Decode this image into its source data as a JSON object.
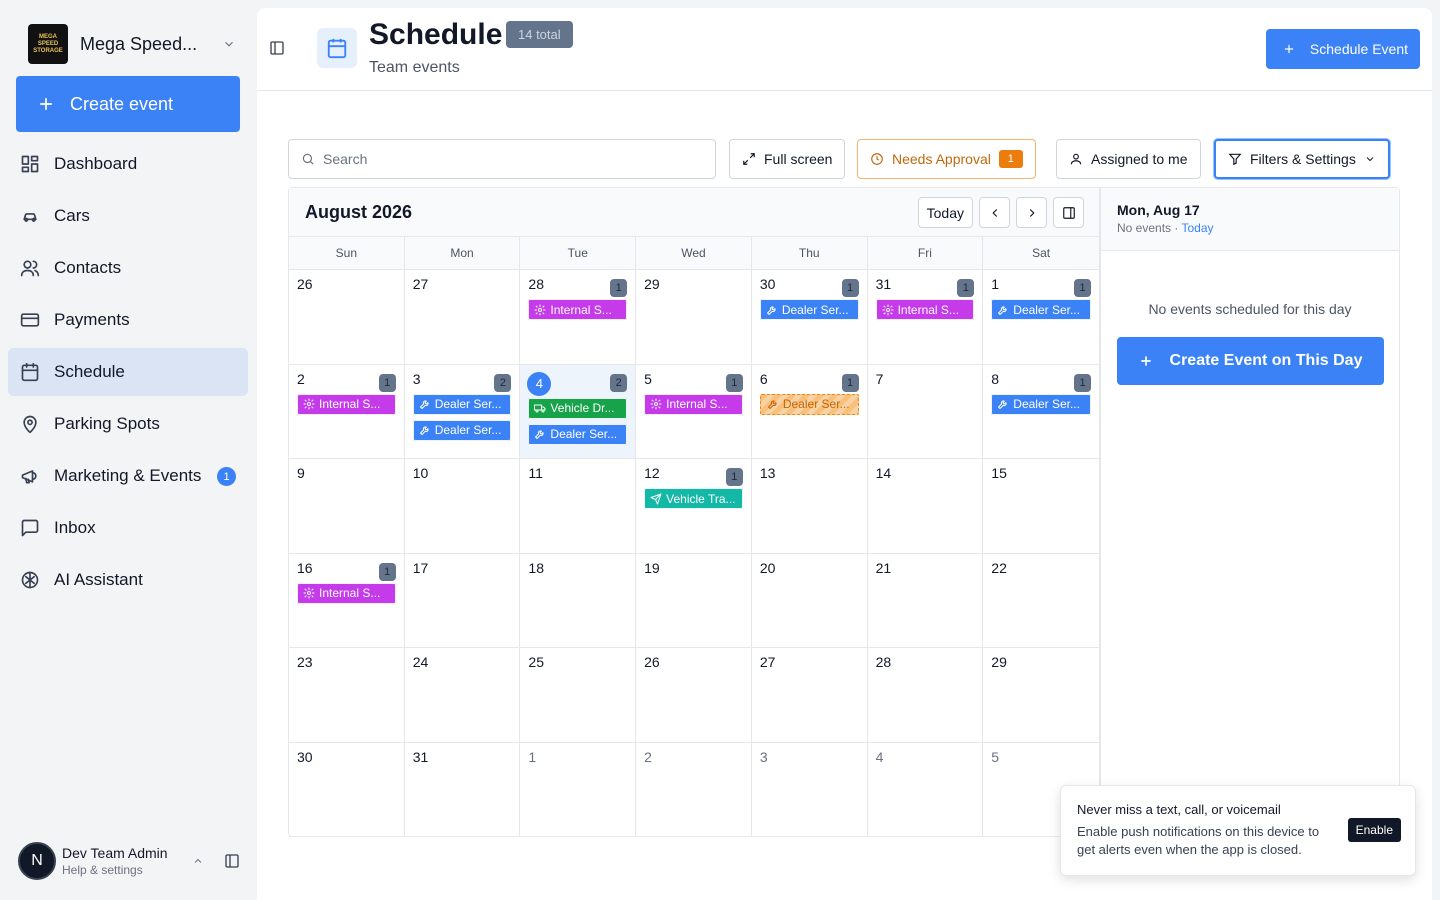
{
  "sidebar": {
    "org_name": "Mega Speed...",
    "org_logo_text": "MEGA SPEED STORAGE",
    "create_label": "Create event",
    "items": [
      {
        "label": "Dashboard",
        "icon": "dashboard-icon"
      },
      {
        "label": "Cars",
        "icon": "car-icon"
      },
      {
        "label": "Contacts",
        "icon": "contacts-icon"
      },
      {
        "label": "Payments",
        "icon": "payments-icon"
      },
      {
        "label": "Schedule",
        "icon": "calendar-icon",
        "active": true
      },
      {
        "label": "Parking Spots",
        "icon": "map-pin-icon"
      },
      {
        "label": "Marketing & Events",
        "icon": "megaphone-icon",
        "badge": "1"
      },
      {
        "label": "Inbox",
        "icon": "inbox-icon"
      },
      {
        "label": "AI Assistant",
        "icon": "ai-icon"
      }
    ],
    "user": {
      "initial": "N",
      "name": "Dev Team Admin",
      "sub": "Help & settings"
    }
  },
  "header": {
    "title": "Schedule",
    "total_badge": "14 total",
    "subtitle": "Team events",
    "schedule_button": "Schedule Event"
  },
  "toolbar": {
    "search_placeholder": "Search",
    "fullscreen_label": "Full screen",
    "approval_label": "Needs Approval",
    "approval_count": "1",
    "assigned_label": "Assigned to me",
    "filters_label": "Filters & Settings"
  },
  "calendar": {
    "month_label": "August 2026",
    "today_label": "Today",
    "weekdays": [
      "Sun",
      "Mon",
      "Tue",
      "Wed",
      "Thu",
      "Fri",
      "Sat"
    ],
    "days": [
      {
        "d": "26",
        "count": "",
        "events": []
      },
      {
        "d": "27",
        "count": "",
        "events": []
      },
      {
        "d": "28",
        "count": "1",
        "events": [
          {
            "type": "internal",
            "label": "Internal S..."
          }
        ]
      },
      {
        "d": "29",
        "count": "",
        "events": []
      },
      {
        "d": "30",
        "count": "1",
        "events": [
          {
            "type": "dealer",
            "label": "Dealer Ser..."
          }
        ]
      },
      {
        "d": "31",
        "count": "1",
        "events": [
          {
            "type": "internal",
            "label": "Internal S..."
          }
        ]
      },
      {
        "d": "1",
        "count": "1",
        "events": [
          {
            "type": "dealer",
            "label": "Dealer Ser..."
          }
        ]
      },
      {
        "d": "2",
        "count": "1",
        "events": [
          {
            "type": "internal",
            "label": "Internal S..."
          }
        ]
      },
      {
        "d": "3",
        "count": "2",
        "events": [
          {
            "type": "dealer",
            "label": "Dealer Ser..."
          },
          {
            "type": "dealer",
            "label": "Dealer Ser..."
          }
        ]
      },
      {
        "d": "4",
        "count": "2",
        "today": true,
        "events": [
          {
            "type": "vehicle",
            "label": "Vehicle Dr..."
          },
          {
            "type": "dealer",
            "label": "Dealer Ser..."
          }
        ]
      },
      {
        "d": "5",
        "count": "1",
        "events": [
          {
            "type": "internal",
            "label": "Internal S..."
          }
        ]
      },
      {
        "d": "6",
        "count": "1",
        "events": [
          {
            "type": "pending",
            "label": "Dealer Ser..."
          }
        ]
      },
      {
        "d": "7",
        "count": "",
        "events": []
      },
      {
        "d": "8",
        "count": "1",
        "events": [
          {
            "type": "dealer",
            "label": "Dealer Ser..."
          }
        ]
      },
      {
        "d": "9",
        "count": "",
        "events": []
      },
      {
        "d": "10",
        "count": "",
        "events": []
      },
      {
        "d": "11",
        "count": "",
        "events": []
      },
      {
        "d": "12",
        "count": "1",
        "events": [
          {
            "type": "transport",
            "label": "Vehicle Tra..."
          }
        ]
      },
      {
        "d": "13",
        "count": "",
        "events": []
      },
      {
        "d": "14",
        "count": "",
        "events": []
      },
      {
        "d": "15",
        "count": "",
        "events": []
      },
      {
        "d": "16",
        "count": "1",
        "events": [
          {
            "type": "internal",
            "label": "Internal S..."
          }
        ]
      },
      {
        "d": "17",
        "count": "",
        "events": []
      },
      {
        "d": "18",
        "count": "",
        "events": []
      },
      {
        "d": "19",
        "count": "",
        "events": []
      },
      {
        "d": "20",
        "count": "",
        "events": []
      },
      {
        "d": "21",
        "count": "",
        "events": []
      },
      {
        "d": "22",
        "count": "",
        "events": []
      },
      {
        "d": "23",
        "count": "",
        "events": []
      },
      {
        "d": "24",
        "count": "",
        "events": []
      },
      {
        "d": "25",
        "count": "",
        "events": []
      },
      {
        "d": "26",
        "count": "",
        "events": []
      },
      {
        "d": "27",
        "count": "",
        "events": []
      },
      {
        "d": "28",
        "count": "",
        "events": []
      },
      {
        "d": "29",
        "count": "",
        "events": []
      },
      {
        "d": "30",
        "count": "",
        "events": []
      },
      {
        "d": "31",
        "count": "",
        "events": []
      },
      {
        "d": "1",
        "count": "",
        "other": true,
        "events": []
      },
      {
        "d": "2",
        "count": "",
        "other": true,
        "events": []
      },
      {
        "d": "3",
        "count": "",
        "other": true,
        "events": []
      },
      {
        "d": "4",
        "count": "",
        "other": true,
        "events": []
      },
      {
        "d": "5",
        "count": "",
        "other": true,
        "events": []
      }
    ]
  },
  "day_panel": {
    "date": "Mon, Aug 17",
    "sub_prefix": "No events · ",
    "today_link": "Today",
    "empty_text": "No events scheduled for this day",
    "create_label": "Create Event on This Day"
  },
  "toast": {
    "title": "Never miss a text, call, or voicemail",
    "body": "Enable push notifications on this device to get alerts even when the app is closed.",
    "button": "Enable"
  },
  "colors": {
    "accent": "#3b82f6",
    "internal": "#c53bea",
    "dealer": "#3b82f6",
    "vehicle": "#16a34a",
    "transport": "#14b8a6",
    "pending": "#ea8a1c"
  }
}
